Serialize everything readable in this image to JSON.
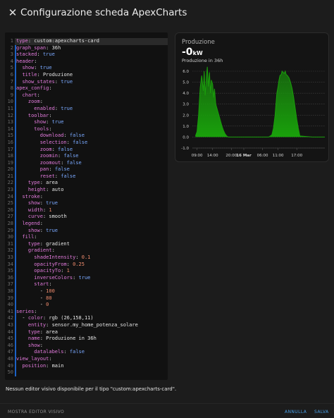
{
  "dialog": {
    "title": "Configurazione scheda ApexCharts",
    "close_icon": "close-icon"
  },
  "editor": {
    "lines": [
      [
        {
          "t": "k",
          "v": "type"
        },
        {
          "t": "s",
          "v": ": custom:apexcharts-card"
        }
      ],
      [
        {
          "t": "k",
          "v": "graph_span"
        },
        {
          "t": "s",
          "v": ": 36h"
        }
      ],
      [
        {
          "t": "k",
          "v": "stacked"
        },
        {
          "t": "s",
          "v": ": "
        },
        {
          "t": "b",
          "v": "true"
        }
      ],
      [
        {
          "t": "k",
          "v": "header"
        },
        {
          "t": "s",
          "v": ":"
        }
      ],
      [
        {
          "t": "s",
          "v": "  "
        },
        {
          "t": "k",
          "v": "show"
        },
        {
          "t": "s",
          "v": ": "
        },
        {
          "t": "b",
          "v": "true"
        }
      ],
      [
        {
          "t": "s",
          "v": "  "
        },
        {
          "t": "k",
          "v": "title"
        },
        {
          "t": "s",
          "v": ": Produzione"
        }
      ],
      [
        {
          "t": "s",
          "v": "  "
        },
        {
          "t": "k",
          "v": "show_states"
        },
        {
          "t": "s",
          "v": ": "
        },
        {
          "t": "b",
          "v": "true"
        }
      ],
      [
        {
          "t": "k",
          "v": "apex_config"
        },
        {
          "t": "s",
          "v": ":"
        }
      ],
      [
        {
          "t": "s",
          "v": "  "
        },
        {
          "t": "k",
          "v": "chart"
        },
        {
          "t": "s",
          "v": ":"
        }
      ],
      [
        {
          "t": "s",
          "v": "    "
        },
        {
          "t": "k",
          "v": "zoom"
        },
        {
          "t": "s",
          "v": ":"
        }
      ],
      [
        {
          "t": "s",
          "v": "      "
        },
        {
          "t": "k",
          "v": "enabled"
        },
        {
          "t": "s",
          "v": ": "
        },
        {
          "t": "b",
          "v": "true"
        }
      ],
      [
        {
          "t": "s",
          "v": "    "
        },
        {
          "t": "k",
          "v": "toolbar"
        },
        {
          "t": "s",
          "v": ":"
        }
      ],
      [
        {
          "t": "s",
          "v": "      "
        },
        {
          "t": "k",
          "v": "show"
        },
        {
          "t": "s",
          "v": ": "
        },
        {
          "t": "b",
          "v": "true"
        }
      ],
      [
        {
          "t": "s",
          "v": "      "
        },
        {
          "t": "k",
          "v": "tools"
        },
        {
          "t": "s",
          "v": ":"
        }
      ],
      [
        {
          "t": "s",
          "v": "        "
        },
        {
          "t": "k",
          "v": "download"
        },
        {
          "t": "s",
          "v": ": "
        },
        {
          "t": "b",
          "v": "false"
        }
      ],
      [
        {
          "t": "s",
          "v": "        "
        },
        {
          "t": "k",
          "v": "selection"
        },
        {
          "t": "s",
          "v": ": "
        },
        {
          "t": "b",
          "v": "false"
        }
      ],
      [
        {
          "t": "s",
          "v": "        "
        },
        {
          "t": "k",
          "v": "zoom"
        },
        {
          "t": "s",
          "v": ": "
        },
        {
          "t": "b",
          "v": "false"
        }
      ],
      [
        {
          "t": "s",
          "v": "        "
        },
        {
          "t": "k",
          "v": "zoomin"
        },
        {
          "t": "s",
          "v": ": "
        },
        {
          "t": "b",
          "v": "false"
        }
      ],
      [
        {
          "t": "s",
          "v": "        "
        },
        {
          "t": "k",
          "v": "zoomout"
        },
        {
          "t": "s",
          "v": ": "
        },
        {
          "t": "b",
          "v": "false"
        }
      ],
      [
        {
          "t": "s",
          "v": "        "
        },
        {
          "t": "k",
          "v": "pan"
        },
        {
          "t": "s",
          "v": ": "
        },
        {
          "t": "b",
          "v": "false"
        }
      ],
      [
        {
          "t": "s",
          "v": "        "
        },
        {
          "t": "k",
          "v": "reset"
        },
        {
          "t": "s",
          "v": ": "
        },
        {
          "t": "b",
          "v": "false"
        }
      ],
      [
        {
          "t": "s",
          "v": "    "
        },
        {
          "t": "k",
          "v": "type"
        },
        {
          "t": "s",
          "v": ": area"
        }
      ],
      [
        {
          "t": "s",
          "v": "    "
        },
        {
          "t": "k",
          "v": "height"
        },
        {
          "t": "s",
          "v": ": auto"
        }
      ],
      [
        {
          "t": "s",
          "v": "  "
        },
        {
          "t": "k",
          "v": "stroke"
        },
        {
          "t": "s",
          "v": ":"
        }
      ],
      [
        {
          "t": "s",
          "v": "    "
        },
        {
          "t": "k",
          "v": "show"
        },
        {
          "t": "s",
          "v": ": "
        },
        {
          "t": "b",
          "v": "true"
        }
      ],
      [
        {
          "t": "s",
          "v": "    "
        },
        {
          "t": "k",
          "v": "width"
        },
        {
          "t": "s",
          "v": ": "
        },
        {
          "t": "n",
          "v": "1"
        }
      ],
      [
        {
          "t": "s",
          "v": "    "
        },
        {
          "t": "k",
          "v": "curve"
        },
        {
          "t": "s",
          "v": ": smooth"
        }
      ],
      [
        {
          "t": "s",
          "v": "  "
        },
        {
          "t": "k",
          "v": "legend"
        },
        {
          "t": "s",
          "v": ":"
        }
      ],
      [
        {
          "t": "s",
          "v": "    "
        },
        {
          "t": "k",
          "v": "show"
        },
        {
          "t": "s",
          "v": ": "
        },
        {
          "t": "b",
          "v": "true"
        }
      ],
      [
        {
          "t": "s",
          "v": "  "
        },
        {
          "t": "k",
          "v": "fill"
        },
        {
          "t": "s",
          "v": ":"
        }
      ],
      [
        {
          "t": "s",
          "v": "    "
        },
        {
          "t": "k",
          "v": "type"
        },
        {
          "t": "s",
          "v": ": gradient"
        }
      ],
      [
        {
          "t": "s",
          "v": "    "
        },
        {
          "t": "k",
          "v": "gradient"
        },
        {
          "t": "s",
          "v": ":"
        }
      ],
      [
        {
          "t": "s",
          "v": "      "
        },
        {
          "t": "k",
          "v": "shadeIntensity"
        },
        {
          "t": "s",
          "v": ": "
        },
        {
          "t": "n",
          "v": "0.1"
        }
      ],
      [
        {
          "t": "s",
          "v": "      "
        },
        {
          "t": "k",
          "v": "opacityFrom"
        },
        {
          "t": "s",
          "v": ": "
        },
        {
          "t": "n",
          "v": "0.25"
        }
      ],
      [
        {
          "t": "s",
          "v": "      "
        },
        {
          "t": "k",
          "v": "opacityTo"
        },
        {
          "t": "s",
          "v": ": "
        },
        {
          "t": "n",
          "v": "1"
        }
      ],
      [
        {
          "t": "s",
          "v": "      "
        },
        {
          "t": "k",
          "v": "inverseColors"
        },
        {
          "t": "s",
          "v": ": "
        },
        {
          "t": "b",
          "v": "true"
        }
      ],
      [
        {
          "t": "s",
          "v": "      "
        },
        {
          "t": "k",
          "v": "start"
        },
        {
          "t": "s",
          "v": ":"
        }
      ],
      [
        {
          "t": "s",
          "v": "        - "
        },
        {
          "t": "n",
          "v": "100"
        }
      ],
      [
        {
          "t": "s",
          "v": "        - "
        },
        {
          "t": "n",
          "v": "80"
        }
      ],
      [
        {
          "t": "s",
          "v": "        - "
        },
        {
          "t": "n",
          "v": "0"
        }
      ],
      [
        {
          "t": "k",
          "v": "series"
        },
        {
          "t": "s",
          "v": ":"
        }
      ],
      [
        {
          "t": "s",
          "v": "  - "
        },
        {
          "t": "k",
          "v": "color"
        },
        {
          "t": "s",
          "v": ": rgb (26,158,11)"
        }
      ],
      [
        {
          "t": "s",
          "v": "    "
        },
        {
          "t": "k",
          "v": "entity"
        },
        {
          "t": "s",
          "v": ": sensor.my_home_potenza_solare"
        }
      ],
      [
        {
          "t": "s",
          "v": "    "
        },
        {
          "t": "k",
          "v": "type"
        },
        {
          "t": "s",
          "v": ": area"
        }
      ],
      [
        {
          "t": "s",
          "v": "    "
        },
        {
          "t": "k",
          "v": "name"
        },
        {
          "t": "s",
          "v": ": Produzione in 36h"
        }
      ],
      [
        {
          "t": "s",
          "v": "    "
        },
        {
          "t": "k",
          "v": "show"
        },
        {
          "t": "s",
          "v": ":"
        }
      ],
      [
        {
          "t": "s",
          "v": "      "
        },
        {
          "t": "k",
          "v": "datalabels"
        },
        {
          "t": "s",
          "v": ": "
        },
        {
          "t": "b",
          "v": "false"
        }
      ],
      [
        {
          "t": "k",
          "v": "view_layout"
        },
        {
          "t": "s",
          "v": ":"
        }
      ],
      [
        {
          "t": "s",
          "v": "  "
        },
        {
          "t": "k",
          "v": "position"
        },
        {
          "t": "s",
          "v": ": main"
        }
      ],
      []
    ]
  },
  "preview": {
    "title": "Produzione",
    "value": "-0",
    "unit": "kW",
    "series_name": "Produzione in 36h"
  },
  "chart_data": {
    "type": "area",
    "series": [
      {
        "name": "Produzione in 36h",
        "color": "#1a9e0b",
        "x": [
          8.5,
          9.0,
          9.5,
          10.0,
          10.5,
          11.0,
          11.3,
          11.6,
          12.0,
          12.3,
          12.6,
          13.0,
          13.3,
          13.6,
          14.0,
          14.3,
          14.6,
          15.0,
          15.5,
          16.0,
          16.5,
          17.0,
          17.5,
          18.0,
          18.5,
          19.0,
          19.5,
          20.0,
          24.0,
          30.0,
          32.0,
          33.0,
          33.5,
          34.0,
          34.3,
          34.6,
          35.0,
          35.3,
          35.6,
          36.0,
          36.3,
          36.6,
          37.0,
          37.3,
          37.6,
          38.0,
          38.5,
          39.0,
          39.5,
          40.0,
          40.5,
          41.0,
          41.5,
          42.0,
          46.0,
          50.0
        ],
        "values": [
          0.1,
          0.5,
          2.0,
          4.5,
          5.6,
          4.2,
          6.0,
          3.8,
          5.5,
          6.4,
          4.6,
          5.9,
          4.0,
          5.2,
          4.8,
          3.6,
          4.4,
          3.0,
          2.5,
          2.0,
          1.5,
          1.0,
          0.6,
          0.3,
          0.1,
          0.0,
          0.0,
          0.0,
          0.0,
          0.0,
          0.0,
          0.2,
          0.8,
          1.9,
          3.0,
          4.0,
          4.6,
          5.2,
          5.6,
          5.7,
          6.0,
          5.9,
          5.8,
          6.0,
          5.7,
          5.6,
          5.4,
          5.0,
          4.4,
          3.6,
          2.6,
          1.6,
          0.8,
          0.1,
          0.0,
          0.0
        ]
      }
    ],
    "y_ticks": [
      "6.0",
      "5.0",
      "4.0",
      "3.0",
      "2.0",
      "1.0",
      "0.0",
      "-1.0"
    ],
    "ylim": [
      -1.0,
      6.0
    ],
    "x_ticks": [
      "09:00",
      "14:00",
      "20:00",
      "16 Mar",
      "06:00",
      "11:00",
      "17:00"
    ],
    "x_tick_values": [
      9,
      14,
      20,
      24,
      30,
      35,
      41
    ],
    "xlim": [
      7.5,
      50
    ],
    "grid": true,
    "legend": "none"
  },
  "footer": {
    "message": "Nessun editor visivo disponibile per il tipo \"custom:apexcharts-card\".",
    "show_visual_editor": "MOSTRA EDITOR VISIVO",
    "cancel": "ANNULLA",
    "save": "SALVA"
  }
}
